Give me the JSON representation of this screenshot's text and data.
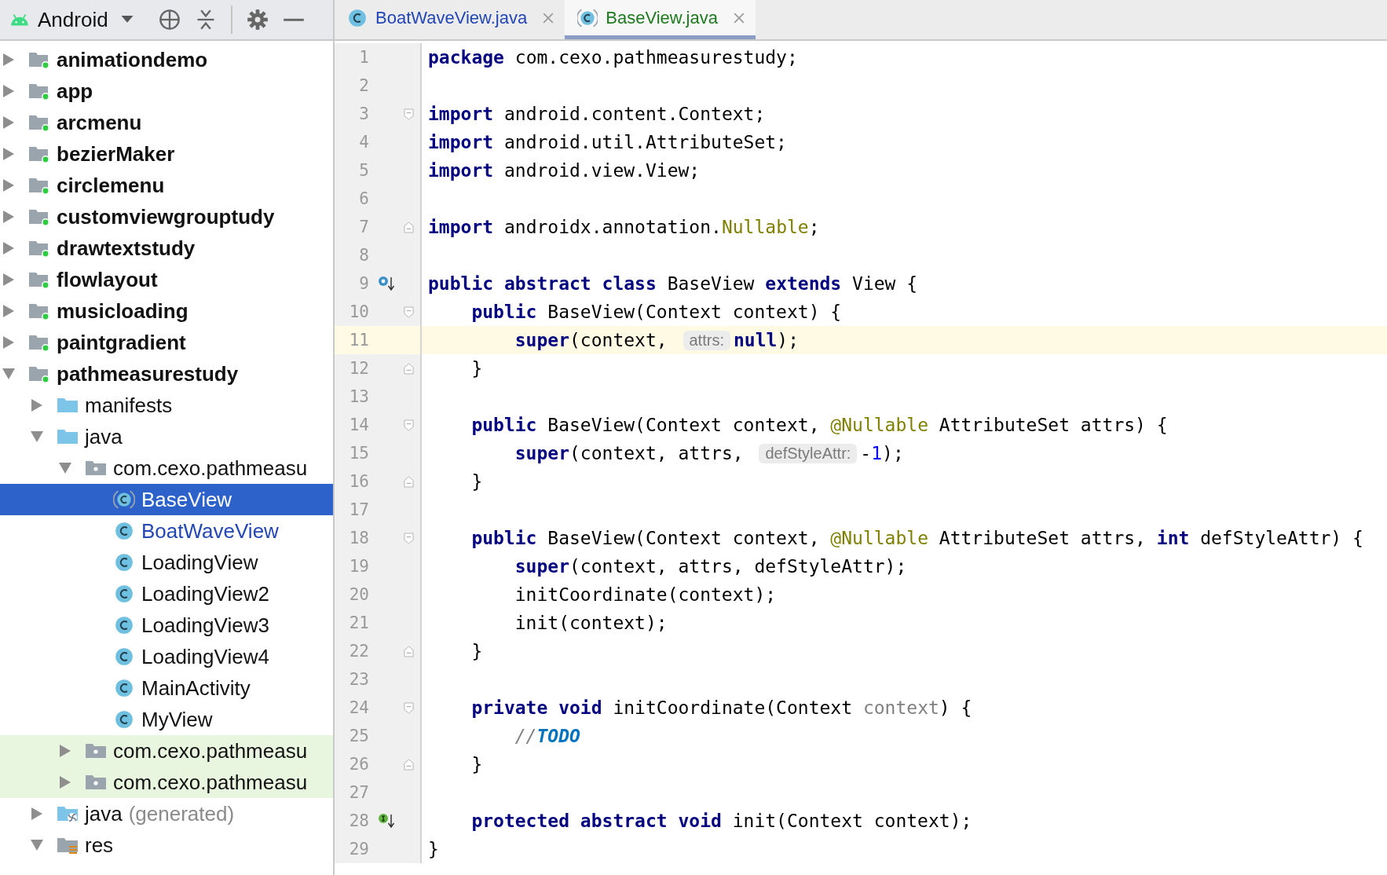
{
  "project_panel": {
    "view_selector": "Android",
    "tree": [
      {
        "label": "animationdemo",
        "kind": "module",
        "expanded": false,
        "selected": false,
        "highlighted": false
      },
      {
        "label": "app",
        "kind": "module",
        "expanded": false,
        "selected": false,
        "highlighted": false
      },
      {
        "label": "arcmenu",
        "kind": "module",
        "expanded": false,
        "selected": false,
        "highlighted": false
      },
      {
        "label": "bezierMaker",
        "kind": "module",
        "expanded": false,
        "selected": false,
        "highlighted": false
      },
      {
        "label": "circlemenu",
        "kind": "module",
        "expanded": false,
        "selected": false,
        "highlighted": false
      },
      {
        "label": "customviewgrouptudy",
        "kind": "module",
        "expanded": false,
        "selected": false,
        "highlighted": false
      },
      {
        "label": "drawtextstudy",
        "kind": "module",
        "expanded": false,
        "selected": false,
        "highlighted": false
      },
      {
        "label": "flowlayout",
        "kind": "module",
        "expanded": false,
        "selected": false,
        "highlighted": false
      },
      {
        "label": "musicloading",
        "kind": "module",
        "expanded": false,
        "selected": false,
        "highlighted": false
      },
      {
        "label": "paintgradient",
        "kind": "module",
        "expanded": false,
        "selected": false,
        "highlighted": false
      },
      {
        "label": "pathmeasurestudy",
        "kind": "module",
        "expanded": true,
        "selected": false,
        "highlighted": false,
        "children": [
          {
            "label": "manifests",
            "kind": "folder",
            "expanded": false,
            "selected": false,
            "highlighted": false
          },
          {
            "label": "java",
            "kind": "folder",
            "expanded": true,
            "selected": false,
            "highlighted": false,
            "children": [
              {
                "label": "com.cexo.pathmeasu",
                "kind": "package",
                "expanded": true,
                "selected": false,
                "highlighted": false,
                "children": [
                  {
                    "label": "BaseView",
                    "kind": "abstract-class",
                    "selected": true,
                    "highlighted": false
                  },
                  {
                    "label": "BoatWaveView",
                    "kind": "class",
                    "color": "#2346b5",
                    "selected": false,
                    "highlighted": false
                  },
                  {
                    "label": "LoadingView",
                    "kind": "class",
                    "selected": false,
                    "highlighted": false
                  },
                  {
                    "label": "LoadingView2",
                    "kind": "class",
                    "selected": false,
                    "highlighted": false
                  },
                  {
                    "label": "LoadingView3",
                    "kind": "class",
                    "selected": false,
                    "highlighted": false
                  },
                  {
                    "label": "LoadingView4",
                    "kind": "class",
                    "selected": false,
                    "highlighted": false
                  },
                  {
                    "label": "MainActivity",
                    "kind": "class",
                    "selected": false,
                    "highlighted": false
                  },
                  {
                    "label": "MyView",
                    "kind": "class",
                    "selected": false,
                    "highlighted": false
                  }
                ]
              },
              {
                "label": "com.cexo.pathmeasu",
                "kind": "package",
                "expanded": false,
                "selected": false,
                "highlighted": true
              },
              {
                "label": "com.cexo.pathmeasu",
                "kind": "package",
                "expanded": false,
                "selected": false,
                "highlighted": true
              }
            ]
          },
          {
            "label": "java",
            "note": "(generated)",
            "kind": "generated",
            "expanded": false,
            "selected": false,
            "highlighted": false
          },
          {
            "label": "res",
            "kind": "res",
            "expanded": true,
            "selected": false,
            "highlighted": false
          }
        ]
      }
    ]
  },
  "tabs": [
    {
      "label": "BoatWaveView.java",
      "kind": "class",
      "color": "#2346b5",
      "selected": false
    },
    {
      "label": "BaseView.java",
      "kind": "abstract-class",
      "color": "#1e7a1e",
      "selected": true
    }
  ],
  "code": {
    "lines": [
      {
        "n": "1",
        "tokens": [
          {
            "kind": "kw",
            "text": "package"
          },
          {
            "kind": "plain",
            "text": " com.cexo.pathmeasurestudy;"
          }
        ]
      },
      {
        "n": "2"
      },
      {
        "n": "3",
        "fold": {
          "kind": "start"
        },
        "tokens": [
          {
            "kind": "kw",
            "text": "import"
          },
          {
            "kind": "plain",
            "text": " android.content.Context;"
          }
        ]
      },
      {
        "n": "4",
        "tokens": [
          {
            "kind": "kw",
            "text": "import"
          },
          {
            "kind": "plain",
            "text": " android.util.AttributeSet;"
          }
        ]
      },
      {
        "n": "5",
        "tokens": [
          {
            "kind": "kw",
            "text": "import"
          },
          {
            "kind": "plain",
            "text": " android.view.View;"
          }
        ]
      },
      {
        "n": "6"
      },
      {
        "n": "7",
        "fold": {
          "kind": "end"
        },
        "tokens": [
          {
            "kind": "kw",
            "text": "import"
          },
          {
            "kind": "plain",
            "text": " androidx.annotation."
          },
          {
            "kind": "ann",
            "text": "Nullable"
          },
          {
            "kind": "plain",
            "text": ";"
          }
        ]
      },
      {
        "n": "8"
      },
      {
        "n": "9",
        "marker": {
          "kind": "override"
        },
        "tokens": [
          {
            "kind": "kw",
            "text": "public abstract class"
          },
          {
            "kind": "plain",
            "text": " BaseView "
          },
          {
            "kind": "kw",
            "text": "extends"
          },
          {
            "kind": "plain",
            "text": " View {"
          }
        ]
      },
      {
        "n": "10",
        "fold": {
          "kind": "start"
        },
        "tokens": [
          {
            "kind": "kw",
            "text": "    public"
          },
          {
            "kind": "plain",
            "text": " BaseView(Context context) {"
          }
        ]
      },
      {
        "n": "11",
        "current": true,
        "tokens": [
          {
            "kind": "kw",
            "text": "        super"
          },
          {
            "kind": "plain",
            "text": "(context, "
          },
          {
            "kind": "hint",
            "text": "attrs:"
          },
          {
            "kind": "kw",
            "text": "null"
          },
          {
            "kind": "plain",
            "text": ");"
          }
        ]
      },
      {
        "n": "12",
        "fold": {
          "kind": "end"
        },
        "tokens": [
          {
            "kind": "plain",
            "text": "    }"
          }
        ]
      },
      {
        "n": "13"
      },
      {
        "n": "14",
        "fold": {
          "kind": "start"
        },
        "tokens": [
          {
            "kind": "kw",
            "text": "    public"
          },
          {
            "kind": "plain",
            "text": " BaseView(Context context, "
          },
          {
            "kind": "ann",
            "text": "@Nullable"
          },
          {
            "kind": "plain",
            "text": " AttributeSet attrs) {"
          }
        ]
      },
      {
        "n": "15",
        "tokens": [
          {
            "kind": "kw",
            "text": "        super"
          },
          {
            "kind": "plain",
            "text": "(context, attrs, "
          },
          {
            "kind": "hint",
            "text": "defStyleAttr:"
          },
          {
            "kind": "plain",
            "text": "-"
          },
          {
            "kind": "num",
            "text": "1"
          },
          {
            "kind": "plain",
            "text": ");"
          }
        ]
      },
      {
        "n": "16",
        "fold": {
          "kind": "end"
        },
        "tokens": [
          {
            "kind": "plain",
            "text": "    }"
          }
        ]
      },
      {
        "n": "17"
      },
      {
        "n": "18",
        "fold": {
          "kind": "start"
        },
        "tokens": [
          {
            "kind": "kw",
            "text": "    public"
          },
          {
            "kind": "plain",
            "text": " BaseView(Context context, "
          },
          {
            "kind": "ann",
            "text": "@Nullable"
          },
          {
            "kind": "plain",
            "text": " AttributeSet attrs, "
          },
          {
            "kind": "kw",
            "text": "int"
          },
          {
            "kind": "plain",
            "text": " defStyleAttr) {"
          }
        ]
      },
      {
        "n": "19",
        "tokens": [
          {
            "kind": "kw",
            "text": "        super"
          },
          {
            "kind": "plain",
            "text": "(context, attrs, defStyleAttr);"
          }
        ]
      },
      {
        "n": "20",
        "tokens": [
          {
            "kind": "plain",
            "text": "        initCoordinate(context);"
          }
        ]
      },
      {
        "n": "21",
        "tokens": [
          {
            "kind": "plain",
            "text": "        init(context);"
          }
        ]
      },
      {
        "n": "22",
        "fold": {
          "kind": "end"
        },
        "tokens": [
          {
            "kind": "plain",
            "text": "    }"
          }
        ]
      },
      {
        "n": "23"
      },
      {
        "n": "24",
        "fold": {
          "kind": "start"
        },
        "tokens": [
          {
            "kind": "kw",
            "text": "    private void"
          },
          {
            "kind": "plain",
            "text": " initCoordinate(Context "
          },
          {
            "kind": "unused",
            "text": "context"
          },
          {
            "kind": "plain",
            "text": ") {"
          }
        ]
      },
      {
        "n": "25",
        "tokens": [
          {
            "kind": "comment",
            "text": "        //"
          },
          {
            "kind": "todo",
            "text": "TODO"
          }
        ]
      },
      {
        "n": "26",
        "fold": {
          "kind": "end"
        },
        "tokens": [
          {
            "kind": "plain",
            "text": "    }"
          }
        ]
      },
      {
        "n": "27"
      },
      {
        "n": "28",
        "marker": {
          "kind": "implement"
        },
        "tokens": [
          {
            "kind": "kw",
            "text": "    protected abstract void"
          },
          {
            "kind": "plain",
            "text": " init(Context context);"
          }
        ]
      },
      {
        "n": "29",
        "tokens": [
          {
            "kind": "plain",
            "text": "}"
          }
        ]
      }
    ]
  }
}
